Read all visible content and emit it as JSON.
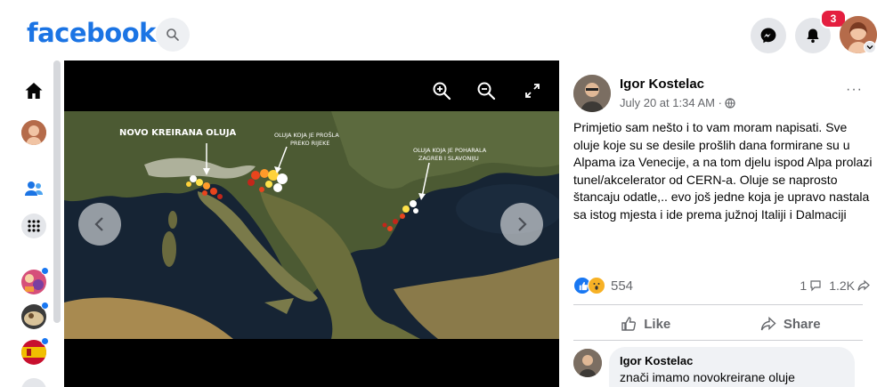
{
  "topbar": {
    "logo": "facebook",
    "notifications_count": "3",
    "brand_color": "#1b74e4",
    "badge_color": "#e41e3f"
  },
  "viewer": {
    "icons": [
      "zoom-in-icon",
      "zoom-out-icon",
      "fullscreen-icon",
      "chevron-left-icon",
      "chevron-right-icon"
    ],
    "map_labels": {
      "label_1": "NOVO KREIRANA OLUJA",
      "label_2_line1": "OLUJA KOJA JE PROŠLA",
      "label_2_line2": "PREKO RIJEKE",
      "label_3_line1": "OLUJA KOJA JE POHARALA",
      "label_3_line2": "ZAGREB I SLAVONIJU"
    }
  },
  "post": {
    "author": "Igor Kostelac",
    "timestamp": "July 20 at 1:34 AM ·",
    "text": "Primjetio sam nešto i to vam moram napisati. Sve oluje koje su se desile prošlih dana formirane su u Alpama iza Venecije, a na tom djelu ispod Alpa prolazi tunel/akcelerator od CERN-a. Oluje se naprosto štancaju odatle,.. evo još jedne koja je upravo nastala sa istog mjesta i ide prema južnoj Italiji i Dalmaciji",
    "more": "···",
    "reactions_count": "554",
    "comments_count": "1",
    "shares_count": "1.2K",
    "like_label": "Like",
    "share_label": "Share"
  },
  "comment": {
    "author": "Igor Kostelac",
    "text": "znači imamo novokreirane oluje"
  }
}
